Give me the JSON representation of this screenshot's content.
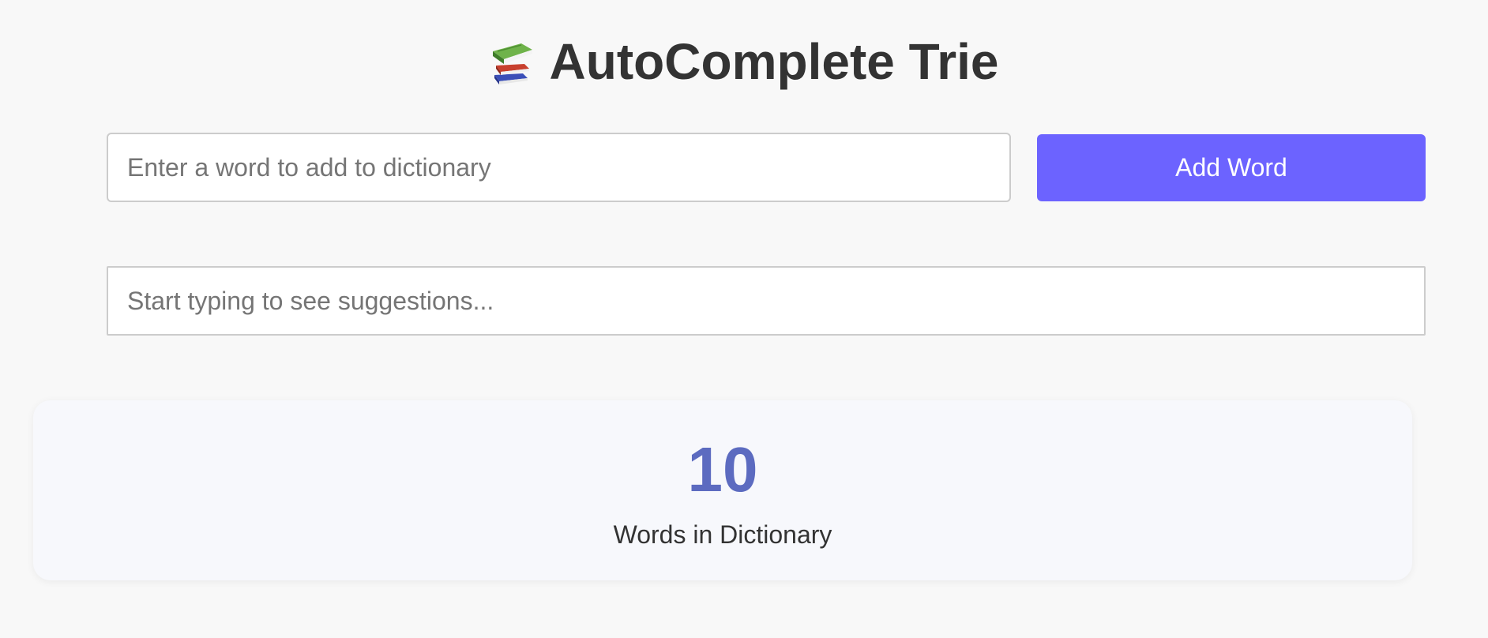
{
  "header": {
    "icon": "books-icon",
    "title": "AutoComplete Trie"
  },
  "add_word": {
    "input_placeholder": "Enter a word to add to dictionary",
    "input_value": "",
    "button_label": "Add Word"
  },
  "search": {
    "placeholder": "Start typing to see suggestions...",
    "value": ""
  },
  "stats": {
    "count": "10",
    "label": "Words in Dictionary"
  },
  "colors": {
    "accent": "#6c63ff",
    "count_color": "#5c6bc0",
    "background": "#f8f8f8",
    "card_background": "#f7f8fc",
    "text": "#333333"
  }
}
